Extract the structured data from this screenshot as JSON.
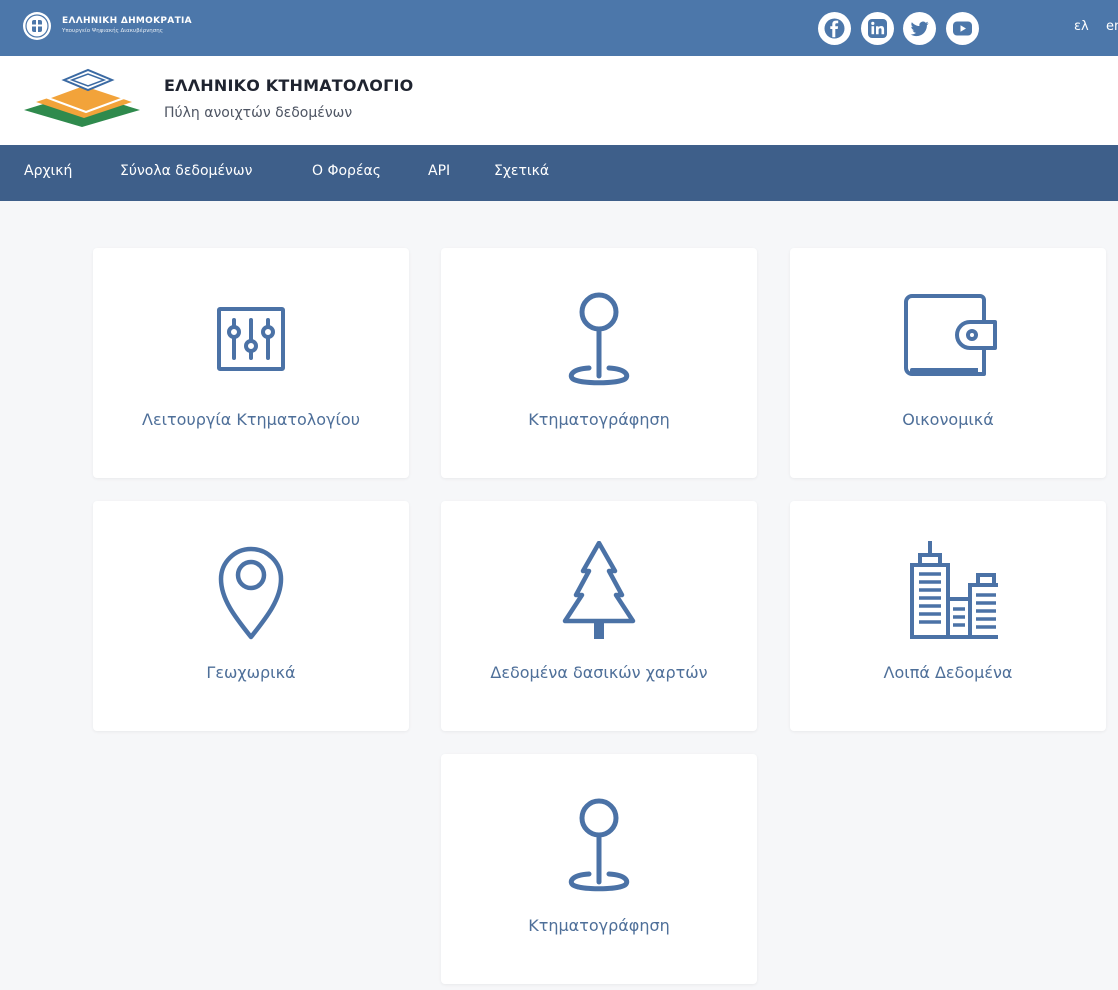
{
  "gov_bar": {
    "title": "ΕΛΛΗΝΙΚΗ ΔΗΜΟΚΡΑΤΙΑ",
    "subtitle": "Υπουργείο Ψηφιακής Διακυβέρνησης",
    "social": [
      "facebook-icon",
      "linkedin-icon",
      "twitter-icon",
      "youtube-icon"
    ],
    "languages": [
      "ελ",
      "en"
    ]
  },
  "header": {
    "title": "ΕΛΛΗΝΙΚΟ ΚΤΗΜΑΤΟΛΟΓΙΟ",
    "subtitle": "Πύλη ανοιχτών δεδομένων"
  },
  "nav": {
    "items": [
      "Αρχική",
      "Σύνολα δεδομένων",
      "Ο Φορέας",
      "API",
      "Σχετικά"
    ]
  },
  "cards": [
    {
      "label": "Λειτουργία Κτηματολογίου",
      "icon": "sliders-icon"
    },
    {
      "label": "Κτηματογράφηση",
      "icon": "map-pin-icon"
    },
    {
      "label": "Οικονομικά",
      "icon": "wallet-icon"
    },
    {
      "label": "Γεωχωρικά",
      "icon": "location-icon"
    },
    {
      "label": "Δεδομένα δασικών χαρτών",
      "icon": "tree-icon"
    },
    {
      "label": "Λοιπά Δεδομένα",
      "icon": "buildings-icon"
    },
    {
      "label": "Κτηματογράφηση",
      "icon": "map-pin-icon"
    }
  ],
  "colors": {
    "gov_bar": "#4c77aa",
    "nav": "#3e5f8a",
    "icon_stroke": "#4b72a6",
    "card_text": "#4e6f99",
    "background": "#f6f7f9"
  }
}
